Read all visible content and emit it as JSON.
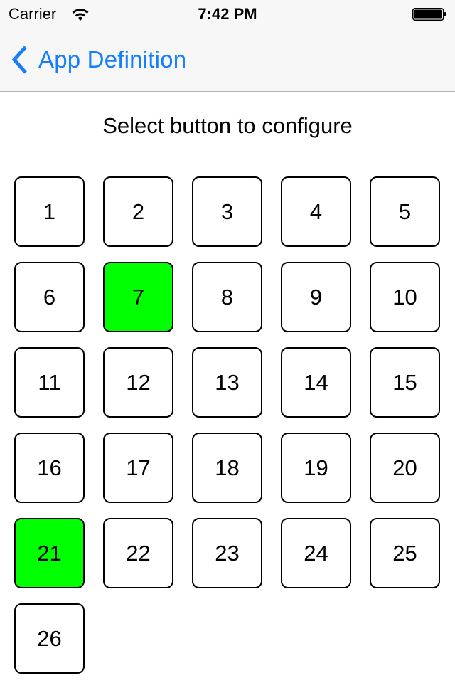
{
  "status_bar": {
    "carrier": "Carrier",
    "wifi_icon": "wifi-icon",
    "time": "7:42 PM",
    "battery_icon": "battery-full-icon",
    "battery_level_percent": 100
  },
  "nav_bar": {
    "back_icon": "chevron-left-icon",
    "back_label": "App Definition",
    "accent_color": "#157efb"
  },
  "main": {
    "instruction": "Select button to configure",
    "selected_color": "#00ff00",
    "buttons": [
      {
        "label": "1",
        "selected": false
      },
      {
        "label": "2",
        "selected": false
      },
      {
        "label": "3",
        "selected": false
      },
      {
        "label": "4",
        "selected": false
      },
      {
        "label": "5",
        "selected": false
      },
      {
        "label": "6",
        "selected": false
      },
      {
        "label": "7",
        "selected": true
      },
      {
        "label": "8",
        "selected": false
      },
      {
        "label": "9",
        "selected": false
      },
      {
        "label": "10",
        "selected": false
      },
      {
        "label": "11",
        "selected": false
      },
      {
        "label": "12",
        "selected": false
      },
      {
        "label": "13",
        "selected": false
      },
      {
        "label": "14",
        "selected": false
      },
      {
        "label": "15",
        "selected": false
      },
      {
        "label": "16",
        "selected": false
      },
      {
        "label": "17",
        "selected": false
      },
      {
        "label": "18",
        "selected": false
      },
      {
        "label": "19",
        "selected": false
      },
      {
        "label": "20",
        "selected": false
      },
      {
        "label": "21",
        "selected": true
      },
      {
        "label": "22",
        "selected": false
      },
      {
        "label": "23",
        "selected": false
      },
      {
        "label": "24",
        "selected": false
      },
      {
        "label": "25",
        "selected": false
      },
      {
        "label": "26",
        "selected": false
      }
    ]
  }
}
